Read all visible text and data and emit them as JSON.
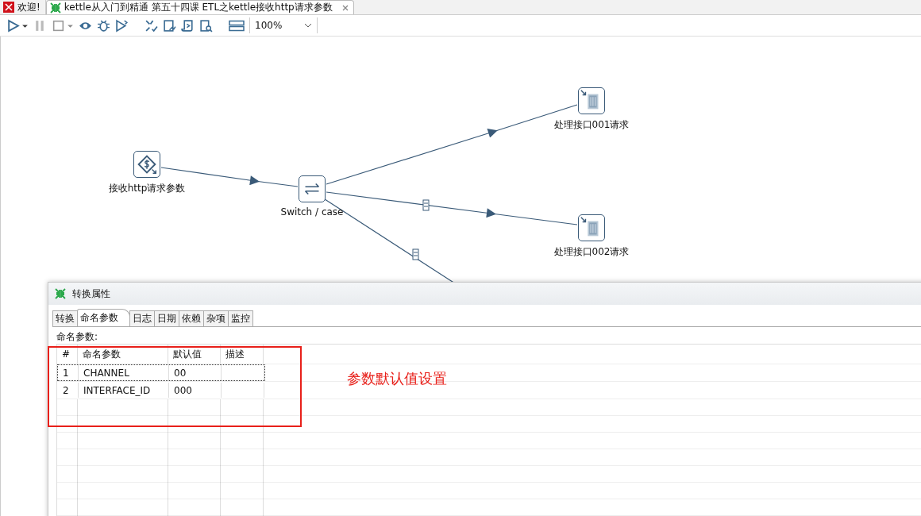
{
  "editor_tabs": [
    {
      "label": "欢迎!",
      "kind": "welcome",
      "selected": false
    },
    {
      "label": "kettle从入门到精通 第五十四课 ETL之kettle接收http请求参数",
      "kind": "transform",
      "selected": true
    }
  ],
  "toolbar": {
    "zoom": "100%"
  },
  "canvas": {
    "steps": [
      {
        "label": "接收http请求参数",
        "kind": "input"
      },
      {
        "label": "Switch / case",
        "kind": "switch"
      },
      {
        "label": "处理接口001请求",
        "kind": "output"
      },
      {
        "label": "处理接口002请求",
        "kind": "output"
      }
    ]
  },
  "dialog": {
    "title": "转换属性",
    "tabs": [
      {
        "label": "转换",
        "selected": false
      },
      {
        "label": "命名参数",
        "selected": true
      },
      {
        "label": "日志",
        "selected": false
      },
      {
        "label": "日期",
        "selected": false
      },
      {
        "label": "依赖",
        "selected": false
      },
      {
        "label": "杂项",
        "selected": false
      },
      {
        "label": "监控",
        "selected": false
      }
    ],
    "section_label": "命名参数:",
    "table": {
      "columns": [
        "#",
        "命名参数",
        "默认值",
        "描述"
      ],
      "rows": [
        {
          "index": "1",
          "name": "CHANNEL",
          "default": "00",
          "selected": true
        },
        {
          "index": "2",
          "name": "INTERFACE_ID",
          "default": "000",
          "selected": false
        }
      ]
    }
  },
  "annotation": "参数默认值设置"
}
